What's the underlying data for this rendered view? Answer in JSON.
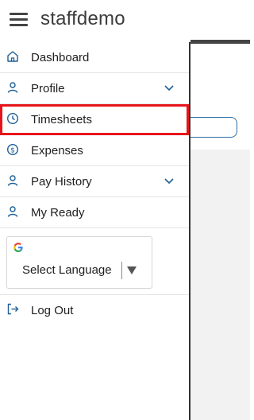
{
  "app": {
    "title": "staffdemo"
  },
  "nav": {
    "items": [
      {
        "label": "Dashboard",
        "icon": "home-icon"
      },
      {
        "label": "Profile",
        "icon": "person-icon",
        "expandable": true
      },
      {
        "label": "Timesheets",
        "icon": "clock-icon",
        "active": true
      },
      {
        "label": "Expenses",
        "icon": "dollar-circle-icon"
      },
      {
        "label": "Pay History",
        "icon": "person-icon",
        "expandable": true
      },
      {
        "label": "My Ready",
        "icon": "person-icon"
      }
    ],
    "language": {
      "selected": "Select Language",
      "icon": "google-icon"
    },
    "logout": {
      "label": "Log Out",
      "icon": "logout-icon"
    }
  },
  "colors": {
    "accent": "#1f5f96",
    "active_border": "#e8141b"
  }
}
